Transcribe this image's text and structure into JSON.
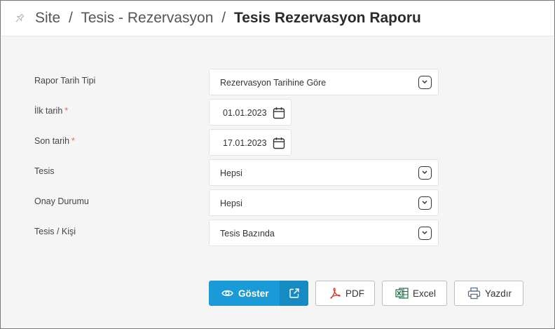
{
  "header": {
    "breadcrumb": [
      "Site",
      "Tesis - Rezervasyon"
    ],
    "separator": "/",
    "current": "Tesis Rezervasyon Raporu"
  },
  "form": {
    "report_date_type": {
      "label": "Rapor Tarih Tipi",
      "value": "Rezervasyon Tarihine Göre"
    },
    "start_date": {
      "label": "İlk tarih",
      "required_mark": "*",
      "value": "01.01.2023"
    },
    "end_date": {
      "label": "Son tarih",
      "required_mark": "*",
      "value": "17.01.2023"
    },
    "facility": {
      "label": "Tesis",
      "value": "Hepsi"
    },
    "approval_status": {
      "label": "Onay Durumu",
      "value": "Hepsi"
    },
    "facility_person": {
      "label": "Tesis / Kişi",
      "value": "Tesis Bazında"
    }
  },
  "actions": {
    "show": "Göster",
    "pdf": "PDF",
    "excel": "Excel",
    "print": "Yazdır"
  },
  "colors": {
    "primary": "#1a9bd7",
    "required": "#e8684a",
    "pdf_red": "#d9342b",
    "excel_green": "#1d7044"
  }
}
